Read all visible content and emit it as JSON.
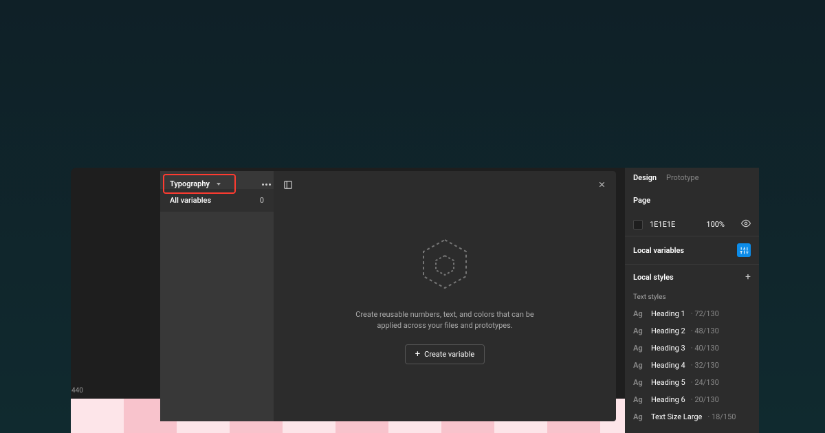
{
  "canvas": {
    "artboard_label": "440"
  },
  "variables_panel": {
    "dropdown_label": "Typography",
    "sidebar": {
      "all_variables_label": "All variables",
      "all_variables_count": "0"
    },
    "empty_state": {
      "text": "Create reusable numbers, text, and colors that can be applied across your files and prototypes.",
      "button_label": "Create variable"
    }
  },
  "right_panel": {
    "tabs": {
      "design": "Design",
      "prototype": "Prototype"
    },
    "page": {
      "label": "Page",
      "color_hex": "1E1E1E",
      "opacity": "100%"
    },
    "local_variables_label": "Local variables",
    "local_styles_label": "Local styles",
    "text_styles_label": "Text styles",
    "text_styles": [
      {
        "name": "Heading 1",
        "meta": "· 72/130"
      },
      {
        "name": "Heading 2",
        "meta": "· 48/130"
      },
      {
        "name": "Heading 3",
        "meta": "· 40/130"
      },
      {
        "name": "Heading 4",
        "meta": "· 32/130"
      },
      {
        "name": "Heading 5",
        "meta": "· 24/130"
      },
      {
        "name": "Heading 6",
        "meta": "· 20/130"
      },
      {
        "name": "Text Size Large",
        "meta": "· 18/150"
      }
    ]
  }
}
